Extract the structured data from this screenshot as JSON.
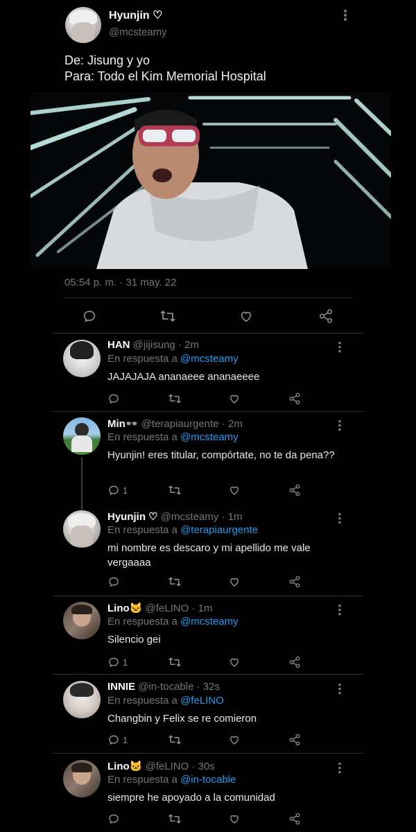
{
  "tweet": {
    "name": "Hyunjin ♡",
    "handle": "@mcsteamy",
    "line1": "De: Jisung y yo",
    "line2": "Para: Todo el Kim Memorial Hospital",
    "timestamp": "05:54 p. m. · 31 may. 22"
  },
  "replies": [
    {
      "name": "HAN",
      "handle": "@jijisung",
      "time": "· 2m",
      "reply_prefix": "En respuesta a ",
      "reply_to": "@mcsteamy",
      "text": "JAJAJAJA ananaeee ananaeeee",
      "reply_count": ""
    },
    {
      "name": "Min👓",
      "handle": "@terapiaurgente",
      "time": "· 2m",
      "reply_prefix": "En respuesta a ",
      "reply_to": "@mcsteamy",
      "text": "Hyunjin! eres titular, compórtate, no te da pena??",
      "reply_count": "1"
    },
    {
      "name": "Hyunjin ♡",
      "handle": "@mcsteamy",
      "time": "· 1m",
      "reply_prefix": "En respuesta a ",
      "reply_to": "@terapiaurgente",
      "text": "mi nombre es descaro y mi apellido me vale vergaaaa",
      "reply_count": ""
    },
    {
      "name": "Lino🐱",
      "handle": "@feLINO",
      "time": "· 1m",
      "reply_prefix": "En respuesta a ",
      "reply_to": "@mcsteamy",
      "text": "Silencio gei",
      "reply_count": "1"
    },
    {
      "name": "INNIE",
      "handle": "@in-tocable",
      "time": "· 32s",
      "reply_prefix": "En respuesta a ",
      "reply_to": "@feLINO",
      "text": "Changbin y Felix se re comieron",
      "reply_count": "1"
    },
    {
      "name": "Lino🐱",
      "handle": "@feLINO",
      "time": "· 30s",
      "reply_prefix": "En respuesta a ",
      "reply_to": "@in-tocable",
      "text": "siempre he apoyado a la comunidad",
      "reply_count": ""
    }
  ],
  "icons": {
    "reply": "comment-icon",
    "retweet": "retweet-icon",
    "like": "heart-icon",
    "share": "share-icon",
    "more": "more-options-icon"
  },
  "colors": {
    "background": "#000000",
    "link": "#1d9bf0",
    "muted": "#71767b",
    "divider": "#2f3336"
  }
}
